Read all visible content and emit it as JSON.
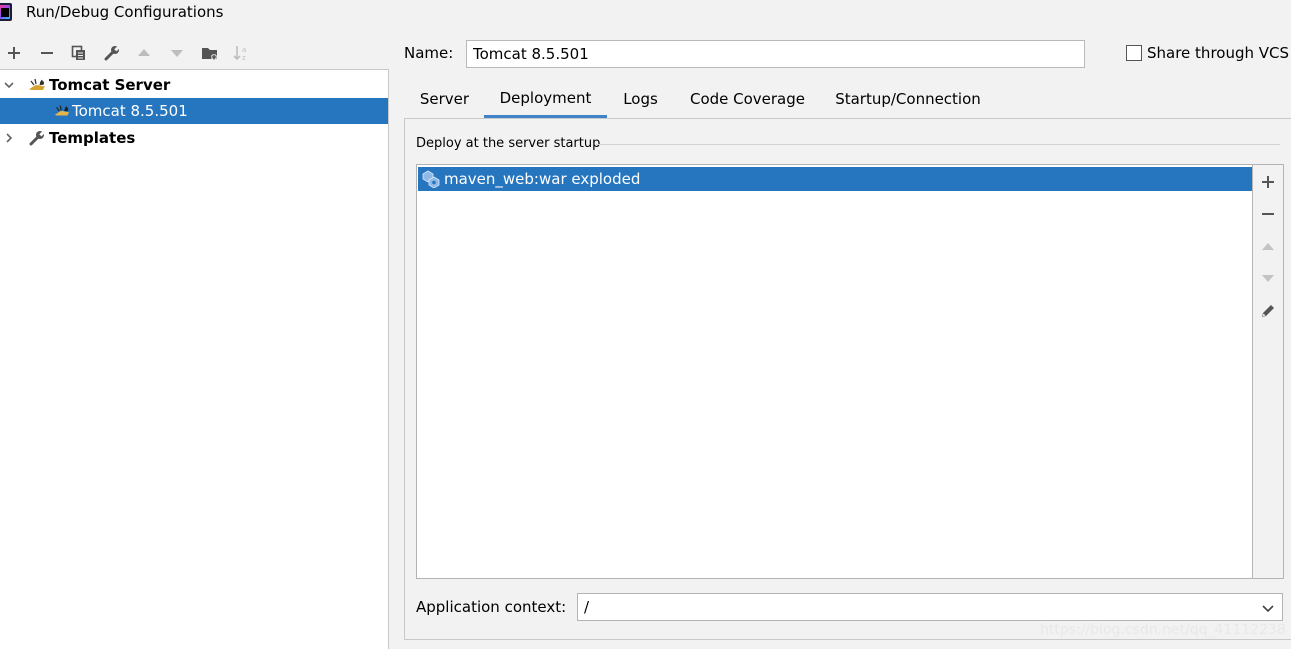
{
  "window": {
    "title": "Run/Debug Configurations"
  },
  "toolbar": {
    "buttons": [
      "add-icon",
      "remove-icon",
      "copy-icon",
      "wrench-icon",
      "move-up-icon",
      "move-down-icon",
      "new-folder-icon",
      "sort-icon"
    ]
  },
  "tree": {
    "items": [
      {
        "label": "Tomcat Server",
        "expanded": true,
        "bold": true,
        "icon": "tomcat-icon"
      },
      {
        "label": "Tomcat 8.5.501",
        "selected": true,
        "icon": "tomcat-config-icon"
      },
      {
        "label": "Templates",
        "expanded": false,
        "bold": true,
        "icon": "wrench-icon"
      }
    ]
  },
  "name_field": {
    "label": "Name:",
    "value": "Tomcat 8.5.501"
  },
  "share": {
    "label": "Share through VCS",
    "checked": false
  },
  "tabs": [
    {
      "label": "Server",
      "active": false
    },
    {
      "label": "Deployment",
      "active": true
    },
    {
      "label": "Logs",
      "active": false
    },
    {
      "label": "Code Coverage",
      "active": false
    },
    {
      "label": "Startup/Connection",
      "active": false
    }
  ],
  "deployment": {
    "section_label": "Deploy at the server startup",
    "artifacts": [
      {
        "label": "maven_web:war exploded",
        "selected": true,
        "icon": "artifact-icon"
      }
    ],
    "side_buttons": [
      "add-icon",
      "remove-icon",
      "move-up-icon",
      "move-down-icon",
      "edit-icon"
    ],
    "application_context": {
      "label": "Application context:",
      "value": "/"
    }
  },
  "watermark": "https://blog.csdn.net/qq_41112238",
  "colors": {
    "selection": "#2675bf",
    "tab_underline": "#4083c9",
    "background": "#f2f2f2"
  }
}
